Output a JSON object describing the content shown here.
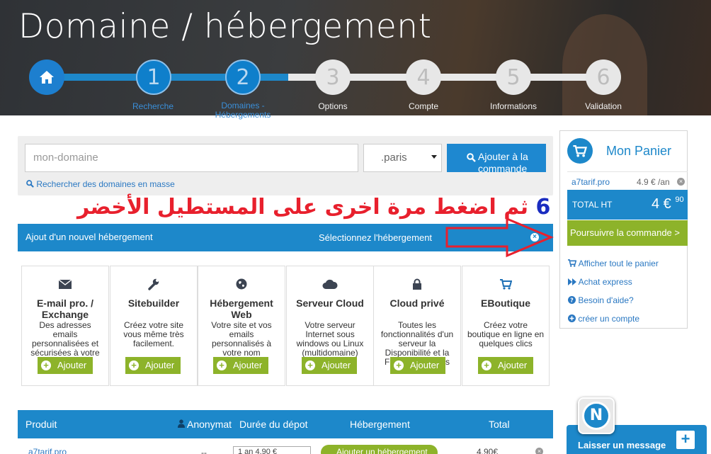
{
  "header": {
    "title": "Domaine / hébergement"
  },
  "steps": [
    {
      "num": "1",
      "label": "Recherche"
    },
    {
      "num": "2",
      "label": "Domaines - Hébergements"
    },
    {
      "num": "3",
      "label": "Options"
    },
    {
      "num": "4",
      "label": "Compte"
    },
    {
      "num": "5",
      "label": "Informations"
    },
    {
      "num": "6",
      "label": "Validation"
    }
  ],
  "search": {
    "placeholder": "mon-domaine",
    "tld": ".paris",
    "add_label": "Ajouter à la commande",
    "mass_link": "Rechercher des domaines en masse"
  },
  "annotation": {
    "num": "6",
    "text": "ثم اضغط مرة اخرى على المستطيل الأخضر"
  },
  "hosting_bar": {
    "title": "Ajout d'un nouvel hébergement",
    "select_label": "Sélectionnez l'hébergement",
    "close": "×"
  },
  "cards": [
    {
      "icon": "envelope-icon",
      "title": "E-mail pro. / Exchange",
      "desc": "Des adresses emails personnalisées et sécurisées à votre",
      "button": "Ajouter"
    },
    {
      "icon": "wrench-icon",
      "title": "Sitebuilder",
      "desc": "Créez votre site vous même très facilement.",
      "button": "Ajouter"
    },
    {
      "icon": "globe-icon",
      "title": "Hébergement Web",
      "desc": "Votre site et vos emails personnalisés à votre nom",
      "button": "Ajouter"
    },
    {
      "icon": "cloud-icon",
      "title": "Serveur Cloud",
      "desc": "Votre serveur Internet sous windows ou Linux (multidomaine)",
      "button": "Ajouter"
    },
    {
      "icon": "lock-icon",
      "title": "Cloud privé",
      "desc": "Toutes les fonctionnalités d'un serveur la Disponibilité et la Flexibilité en plus",
      "button": "Ajouter"
    },
    {
      "icon": "cart-icon",
      "title": "EBoutique",
      "desc": "Créez votre boutique en ligne en quelques clics",
      "button": "Ajouter"
    }
  ],
  "table": {
    "headers": {
      "product": "Produit",
      "anon": "Anonymat",
      "duration": "Durée du dépot",
      "hosting": "Hébergement",
      "total": "Total"
    },
    "row": {
      "product": "a7tarif.pro",
      "anon": "--",
      "duration": "1 an 4.90 €",
      "hosting": "Ajouter un hébergement",
      "total": "4.90€"
    }
  },
  "cart": {
    "title": "Mon Panier",
    "item": "a7tarif.pro",
    "item_price": "4.9 € /an",
    "total_label": "TOTAL HT",
    "total_value": "4 €",
    "total_cents": "90",
    "proceed": "Poursuivre la commande >",
    "links": [
      "Afficher tout le panier",
      "Achat express",
      "Besoin d'aide?",
      "créer un compte"
    ]
  },
  "chat": {
    "label": "Laisser un message",
    "badge": "N"
  },
  "colors": {
    "blue": "#1d88ca",
    "green": "#8db32a",
    "annotation_red": "#e8202d"
  }
}
